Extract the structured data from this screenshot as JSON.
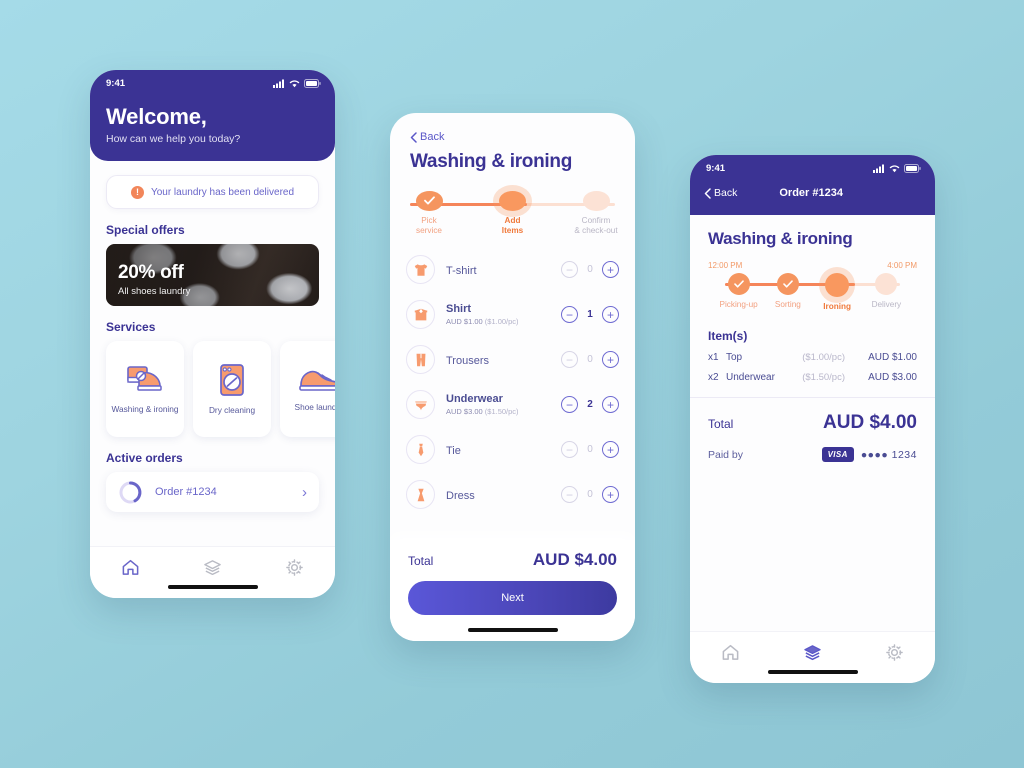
{
  "background_color": "#9ed4e0",
  "brand": {
    "purple": "#3b3394",
    "orange": "#f5894f",
    "lavender": "#6a66c9"
  },
  "phone_home": {
    "status_bar": {
      "time": "9:41",
      "signal_icon": "cellular-signal-icon",
      "wifi_icon": "wifi-icon",
      "battery_icon": "battery-icon"
    },
    "header": {
      "title": "Welcome,",
      "subtitle": "How can we help you today?"
    },
    "notification": {
      "icon": "alert-circle-icon",
      "glyph": "!",
      "text": "Your laundry has been delivered"
    },
    "special_offers": {
      "section_title": "Special offers",
      "promo": {
        "headline": "20% off",
        "subtext": "All shoes laundry",
        "image_alt": "white-sneakers-photo"
      }
    },
    "services": {
      "section_title": "Services",
      "items": [
        {
          "label": "Washing &\nironing",
          "icon": "washing-ironing-icon"
        },
        {
          "label": "Dry cleaning",
          "icon": "washing-machine-icon"
        },
        {
          "label": "Shoe laundry",
          "icon": "sneaker-icon"
        }
      ]
    },
    "active_orders": {
      "section_title": "Active orders",
      "orders": [
        {
          "label": "Order #1234",
          "progress_icon": "progress-ring-icon",
          "chevron": "›"
        }
      ]
    },
    "tab_bar": {
      "items": [
        {
          "name": "home",
          "icon": "home-icon",
          "active": true
        },
        {
          "name": "orders",
          "icon": "layers-icon",
          "active": false
        },
        {
          "name": "settings",
          "icon": "gear-icon",
          "active": false
        }
      ]
    }
  },
  "phone_items": {
    "back": {
      "label": "Back",
      "icon": "chevron-left-icon"
    },
    "title": "Washing & ironing",
    "stepper": {
      "steps": [
        {
          "label": "Pick\nservice",
          "state": "done",
          "icon": "check-icon"
        },
        {
          "label": "Add\nItems",
          "state": "current"
        },
        {
          "label": "Confirm\n& check-out",
          "state": "todo"
        }
      ]
    },
    "items": [
      {
        "name": "T-shirt",
        "icon": "tshirt-icon",
        "price_line": "",
        "unit_price": "",
        "qty": "0",
        "selected": false
      },
      {
        "name": "Shirt",
        "icon": "shirt-icon",
        "price_line": "AUD $1.00",
        "unit_price": "($1.00/pc)",
        "qty": "1",
        "selected": true
      },
      {
        "name": "Trousers",
        "icon": "trousers-icon",
        "price_line": "",
        "unit_price": "",
        "qty": "0",
        "selected": false
      },
      {
        "name": "Underwear",
        "icon": "underwear-icon",
        "price_line": "AUD $3.00",
        "unit_price": "($1.50/pc)",
        "qty": "2",
        "selected": true
      },
      {
        "name": "Tie",
        "icon": "tie-icon",
        "price_line": "",
        "unit_price": "",
        "qty": "0",
        "selected": false
      },
      {
        "name": "Dress",
        "icon": "dress-icon",
        "price_line": "",
        "unit_price": "",
        "qty": "0",
        "selected": false
      }
    ],
    "footer": {
      "total_label": "Total",
      "total_amount": "AUD $4.00",
      "next_label": "Next"
    }
  },
  "phone_order": {
    "status_bar": {
      "time": "9:41",
      "signal_icon": "cellular-signal-icon",
      "wifi_icon": "wifi-icon",
      "battery_icon": "battery-icon"
    },
    "nav": {
      "back_label": "Back",
      "title": "Order #1234"
    },
    "title": "Washing & ironing",
    "times": {
      "start": "12:00 PM",
      "end": "4:00 PM"
    },
    "stepper": {
      "steps": [
        {
          "label": "Picking-up",
          "state": "done",
          "icon": "check-icon"
        },
        {
          "label": "Sorting",
          "state": "done",
          "icon": "check-icon"
        },
        {
          "label": "Ironing",
          "state": "current"
        },
        {
          "label": "Delivery",
          "state": "todo"
        }
      ]
    },
    "items_heading": "Item(s)",
    "items": [
      {
        "qty": "x1",
        "name": "Top",
        "unit": "($1.00/pc)",
        "amount": "AUD $1.00"
      },
      {
        "qty": "x2",
        "name": "Underwear",
        "unit": "($1.50/pc)",
        "amount": "AUD $3.00"
      }
    ],
    "total": {
      "label": "Total",
      "amount": "AUD $4.00"
    },
    "payment": {
      "label": "Paid by",
      "brand": "VISA",
      "masked": "●●●● 1234"
    },
    "tab_bar": {
      "items": [
        {
          "name": "home",
          "icon": "home-icon",
          "active": false
        },
        {
          "name": "orders",
          "icon": "layers-icon",
          "active": true
        },
        {
          "name": "settings",
          "icon": "gear-icon",
          "active": false
        }
      ]
    }
  }
}
